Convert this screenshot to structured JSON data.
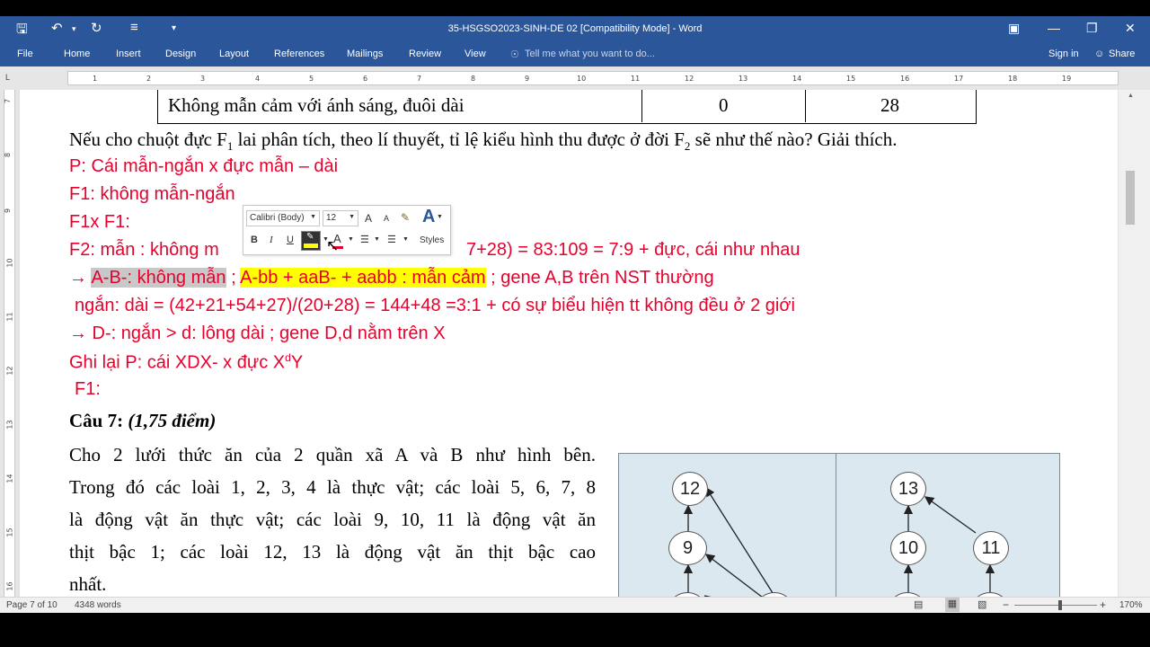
{
  "window": {
    "title": "35-HSGSO2023-SINH-DE 02 [Compatibility Mode] - Word",
    "quick_access": {
      "save_icon": "save-icon",
      "undo_icon": "undo-icon",
      "redo_icon": "redo-icon",
      "format_icon": "format-painter-icon",
      "customize_icon": "customize-icon"
    },
    "buttons": {
      "ribbon_display_icon": "ribbon-display-icon",
      "minimize_icon": "minimize-icon",
      "restore_icon": "restore-icon",
      "close_icon": "close-icon"
    }
  },
  "ribbon": {
    "tabs": [
      "File",
      "Home",
      "Insert",
      "Design",
      "Layout",
      "References",
      "Mailings",
      "Review",
      "View"
    ],
    "tell_me": "Tell me what you want to do...",
    "sign_in": "Sign in",
    "share": "Share"
  },
  "ruler": {
    "numbers": [
      "1",
      "2",
      "3",
      "4",
      "5",
      "6",
      "7",
      "8",
      "9",
      "10",
      "11",
      "12",
      "13",
      "14",
      "15",
      "16",
      "17",
      "18",
      "19"
    ],
    "vertical": [
      "7",
      "8",
      "9",
      "10",
      "11",
      "12",
      "13",
      "14",
      "15",
      "16"
    ]
  },
  "document": {
    "table_row": {
      "label": "Không mẫn cảm với ánh sáng, đuôi dài",
      "v1": "0",
      "v2": "28"
    },
    "question": "Nếu cho chuột đực F",
    "question_sub1": "1",
    "question_mid": " lai phân tích, theo lí thuyết, tỉ lệ kiểu hình thu được ở đời F",
    "question_sub2": "2",
    "question_end": " sẽ như thế nào? Giải thích.",
    "l1": "P: Cái mẫn-ngắn  x đực mẫn – dài",
    "l2": "F1: không mẫn-ngắn",
    "l3": "F1x F1:",
    "l4a": "F2: mẫn : không m",
    "l4b": "7+28) = 83:109 = 7:9  + đực, cái như nhau",
    "l5_arrow": "→",
    "l5_gray": "A-B-: không mẫn",
    "l5_sep": " ; ",
    "l5_yellow": "A-bb + aaB- + aabb : mẫn cảm",
    "l5_rest": " ; gene A,B trên NST thường",
    "l6": "ngắn: dài = (42+21+54+27)/(20+28) = 144+48 =3:1 + có sự biểu hiện tt không đều ở 2 giới",
    "l7": "→ D-: ngắn > d: lông dài ; gene D,d nằm trên X",
    "l8a": "Ghi lại P: cái     XDX-  x  đực X",
    "l8sup": "d",
    "l8b": "Y",
    "l9": "F1:",
    "cau_title": "Câu 7: ",
    "cau_points": "(1,75 điểm)",
    "para": [
      "Cho 2 lưới thức ăn của 2 quần xã A và B như hình bên.",
      "Trong đó các loài 1, 2, 3, 4 là thực vật; các loài 5, 6, 7, 8",
      "là động vật ăn thực vật; các loài 9, 10, 11 là động vật ăn",
      "thịt bậc 1; các loài 12, 13 là động vật ăn thịt bậc cao",
      "nhất."
    ],
    "diagram_nodes": [
      "12",
      "9",
      "13",
      "10",
      "11"
    ]
  },
  "mini_toolbar": {
    "font": "Calibri (Body)",
    "size": "12",
    "grow": "A",
    "shrink": "A",
    "bold": "B",
    "italic": "I",
    "underline": "U",
    "styles": "Styles",
    "highlight_color": "#ffff00",
    "font_color": "#e8002d"
  },
  "status": {
    "page": "Page 7 of 10",
    "words": "4348 words",
    "zoom": "170%",
    "zoom_out": "−",
    "zoom_in": "+"
  }
}
